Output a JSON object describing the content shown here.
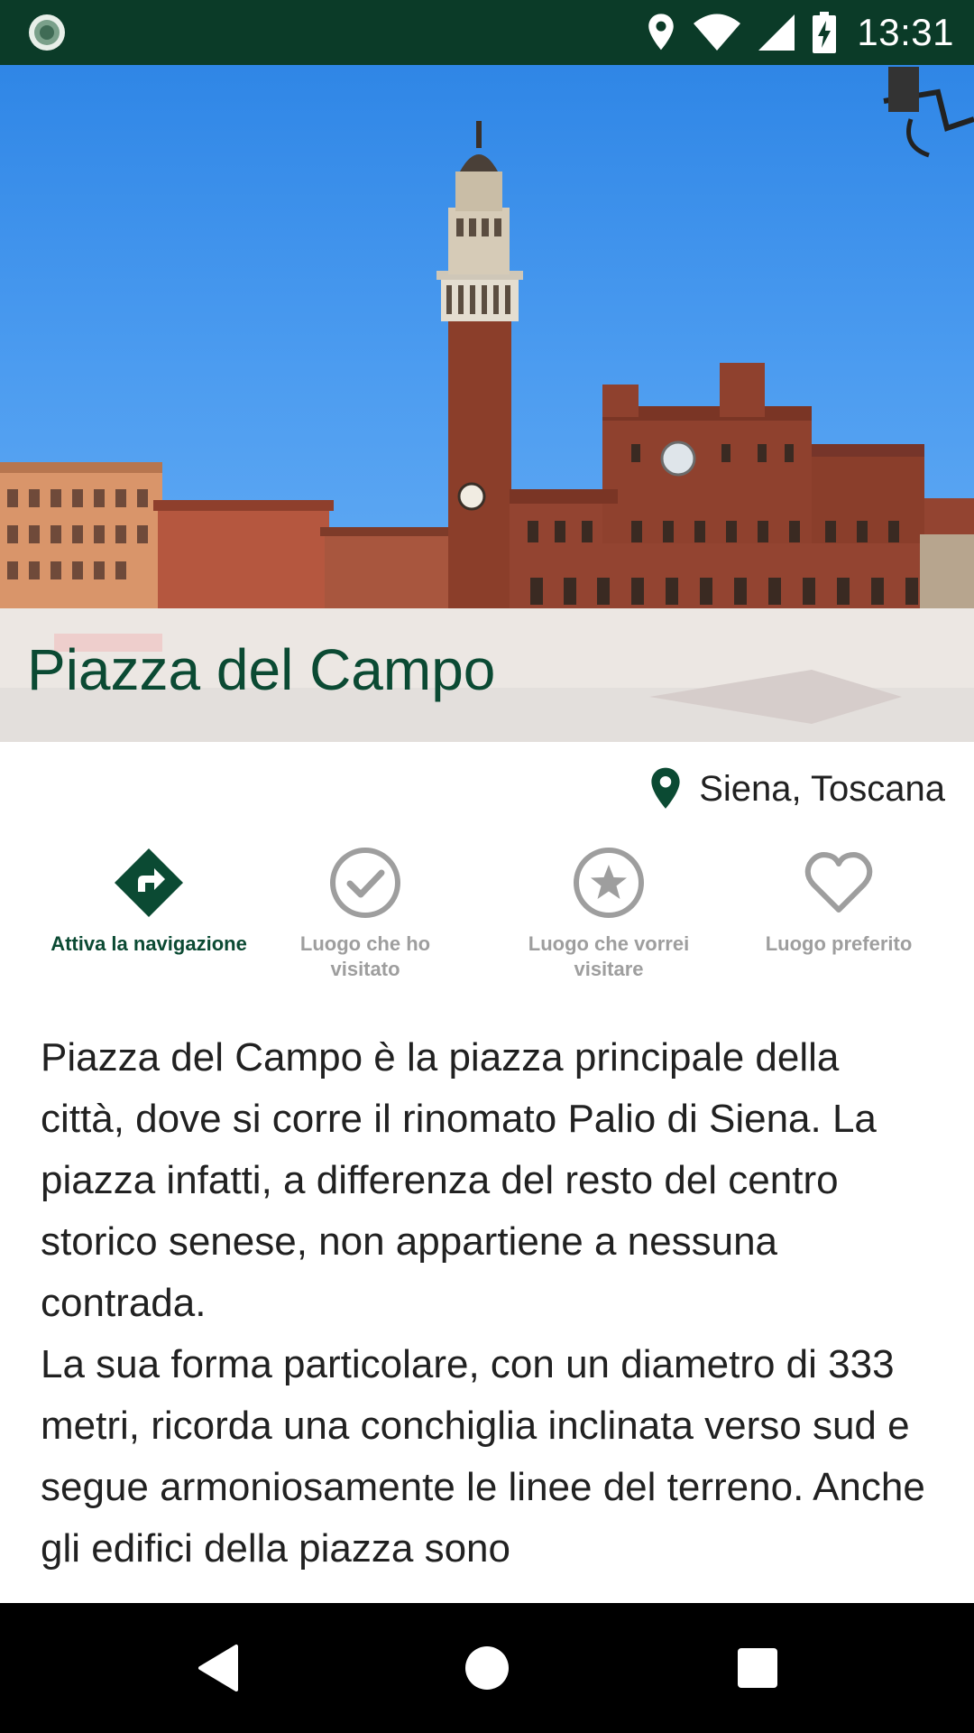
{
  "status_bar": {
    "time": "13:31",
    "icons": [
      "app-notification-icon",
      "location-icon",
      "wifi-icon",
      "signal-icon",
      "battery-charging-icon"
    ]
  },
  "place": {
    "title": "Piazza del Campo",
    "location": "Siena, Toscana"
  },
  "actions": [
    {
      "label": "Attiva la navigazione",
      "icon": "navigation-icon",
      "active": true
    },
    {
      "label": "Luogo che ho visitato",
      "icon": "check-circle-icon",
      "active": false
    },
    {
      "label": "Luogo che vorrei visitare",
      "icon": "star-circle-icon",
      "active": false
    },
    {
      "label": "Luogo preferito",
      "icon": "heart-icon",
      "active": false
    }
  ],
  "description": {
    "paragraphs": [
      "Piazza del Campo è la piazza principale della città, dove si corre il rinomato Palio di Siena. La piazza infatti, a differenza del resto del centro storico senese, non appartiene a nessuna contrada.",
      "La sua forma particolare, con un diametro di 333 metri, ricorda una conchiglia inclinata verso sud e segue armoniosamente le linee del terreno. Anche gli edifici della piazza sono"
    ]
  },
  "nav_bar": {
    "icons": [
      "back-icon",
      "home-icon",
      "recents-icon"
    ]
  },
  "colors": {
    "status_bar": "#0b3b28",
    "accent": "#0b4a33",
    "inactive": "#9e9e9e",
    "text": "#212121"
  }
}
